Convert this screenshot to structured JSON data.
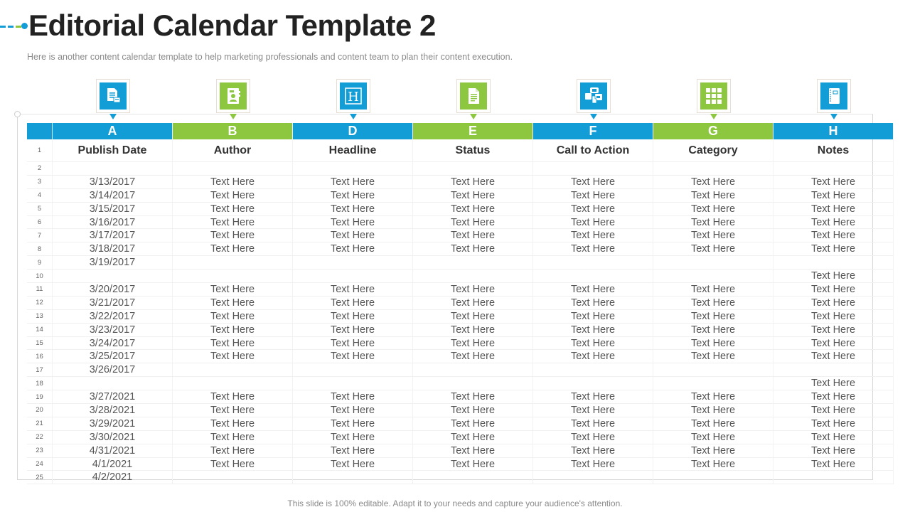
{
  "colors": {
    "blue": "#129dd6",
    "green": "#8dc63f",
    "title": "#222222",
    "subtitle": "#8a8a8a"
  },
  "header": {
    "title": "Editorial Calendar Template 2",
    "subtitle": "Here is another content calendar template to help marketing professionals and content team to plan their content execution."
  },
  "columns": [
    {
      "letter": "A",
      "label": "Publish Date",
      "color": "blue",
      "icon": "document-list-icon"
    },
    {
      "letter": "B",
      "label": "Author",
      "color": "green",
      "icon": "contact-book-icon"
    },
    {
      "letter": "D",
      "label": "Headline",
      "color": "blue",
      "icon": "heading-h-icon"
    },
    {
      "letter": "E",
      "label": "Status",
      "color": "green",
      "icon": "document-page-icon"
    },
    {
      "letter": "F",
      "label": "Call to Action",
      "color": "blue",
      "icon": "touch-click-icon"
    },
    {
      "letter": "G",
      "label": "Category",
      "color": "green",
      "icon": "grid-icon"
    },
    {
      "letter": "H",
      "label": "Notes",
      "color": "blue",
      "icon": "notebook-icon"
    }
  ],
  "rows": [
    {
      "n": "1",
      "cells": [
        "Publish Date",
        "Author",
        "Headline",
        "Status",
        "Call to Action",
        "Category",
        "Notes"
      ]
    },
    {
      "n": "2",
      "cells": [
        "",
        "",
        "",
        "",
        "",
        "",
        ""
      ]
    },
    {
      "n": "3",
      "cells": [
        "3/13/2017",
        "Text Here",
        "Text Here",
        "Text Here",
        "Text Here",
        "Text Here",
        "Text Here"
      ]
    },
    {
      "n": "4",
      "cells": [
        "3/14/2017",
        "Text Here",
        "Text Here",
        "Text Here",
        "Text Here",
        "Text Here",
        "Text Here"
      ]
    },
    {
      "n": "5",
      "cells": [
        "3/15/2017",
        "Text Here",
        "Text Here",
        "Text Here",
        "Text Here",
        "Text Here",
        "Text Here"
      ]
    },
    {
      "n": "6",
      "cells": [
        "3/16/2017",
        "Text Here",
        "Text Here",
        "Text Here",
        "Text Here",
        "Text Here",
        "Text Here"
      ]
    },
    {
      "n": "7",
      "cells": [
        "3/17/2017",
        "Text Here",
        "Text Here",
        "Text Here",
        "Text Here",
        "Text Here",
        "Text Here"
      ]
    },
    {
      "n": "8",
      "cells": [
        "3/18/2017",
        "Text Here",
        "Text Here",
        "Text Here",
        "Text Here",
        "Text Here",
        "Text Here"
      ]
    },
    {
      "n": "9",
      "cells": [
        "3/19/2017",
        "",
        "",
        "",
        "",
        "",
        ""
      ]
    },
    {
      "n": "10",
      "cells": [
        "",
        "",
        "",
        "",
        "",
        "",
        "Text Here"
      ]
    },
    {
      "n": "11",
      "cells": [
        "3/20/2017",
        "Text Here",
        "Text Here",
        "Text Here",
        "Text Here",
        "Text Here",
        "Text Here"
      ]
    },
    {
      "n": "12",
      "cells": [
        "3/21/2017",
        "Text Here",
        "Text Here",
        "Text Here",
        "Text Here",
        "Text Here",
        "Text Here"
      ]
    },
    {
      "n": "13",
      "cells": [
        "3/22/2017",
        "Text Here",
        "Text Here",
        "Text Here",
        "Text Here",
        "Text Here",
        "Text Here"
      ]
    },
    {
      "n": "14",
      "cells": [
        "3/23/2017",
        "Text Here",
        "Text Here",
        "Text Here",
        "Text Here",
        "Text Here",
        "Text Here"
      ]
    },
    {
      "n": "15",
      "cells": [
        "3/24/2017",
        "Text Here",
        "Text Here",
        "Text Here",
        "Text Here",
        "Text Here",
        "Text Here"
      ]
    },
    {
      "n": "16",
      "cells": [
        "3/25/2017",
        "Text Here",
        "Text Here",
        "Text Here",
        "Text Here",
        "Text Here",
        "Text Here"
      ]
    },
    {
      "n": "17",
      "cells": [
        "3/26/2017",
        "",
        "",
        "",
        "",
        "",
        ""
      ]
    },
    {
      "n": "18",
      "cells": [
        "",
        "",
        "",
        "",
        "",
        "",
        "Text Here"
      ]
    },
    {
      "n": "19",
      "cells": [
        "3/27/2021",
        "Text Here",
        "Text Here",
        "Text Here",
        "Text Here",
        "Text Here",
        "Text Here"
      ]
    },
    {
      "n": "20",
      "cells": [
        "3/28/2021",
        "Text Here",
        "Text Here",
        "Text Here",
        "Text Here",
        "Text Here",
        "Text Here"
      ]
    },
    {
      "n": "21",
      "cells": [
        "3/29/2021",
        "Text Here",
        "Text Here",
        "Text Here",
        "Text Here",
        "Text Here",
        "Text Here"
      ]
    },
    {
      "n": "22",
      "cells": [
        "3/30/2021",
        "Text Here",
        "Text Here",
        "Text Here",
        "Text Here",
        "Text Here",
        "Text Here"
      ]
    },
    {
      "n": "23",
      "cells": [
        "4/31/2021",
        "Text Here",
        "Text Here",
        "Text Here",
        "Text Here",
        "Text Here",
        "Text Here"
      ]
    },
    {
      "n": "24",
      "cells": [
        "4/1/2021",
        "Text Here",
        "Text Here",
        "Text Here",
        "Text Here",
        "Text Here",
        "Text Here"
      ]
    },
    {
      "n": "25",
      "cells": [
        "4/2/2021",
        "",
        "",
        "",
        "",
        "",
        ""
      ]
    }
  ],
  "footer": {
    "text": "This slide is 100% editable. Adapt it to your needs and capture your audience's attention."
  }
}
